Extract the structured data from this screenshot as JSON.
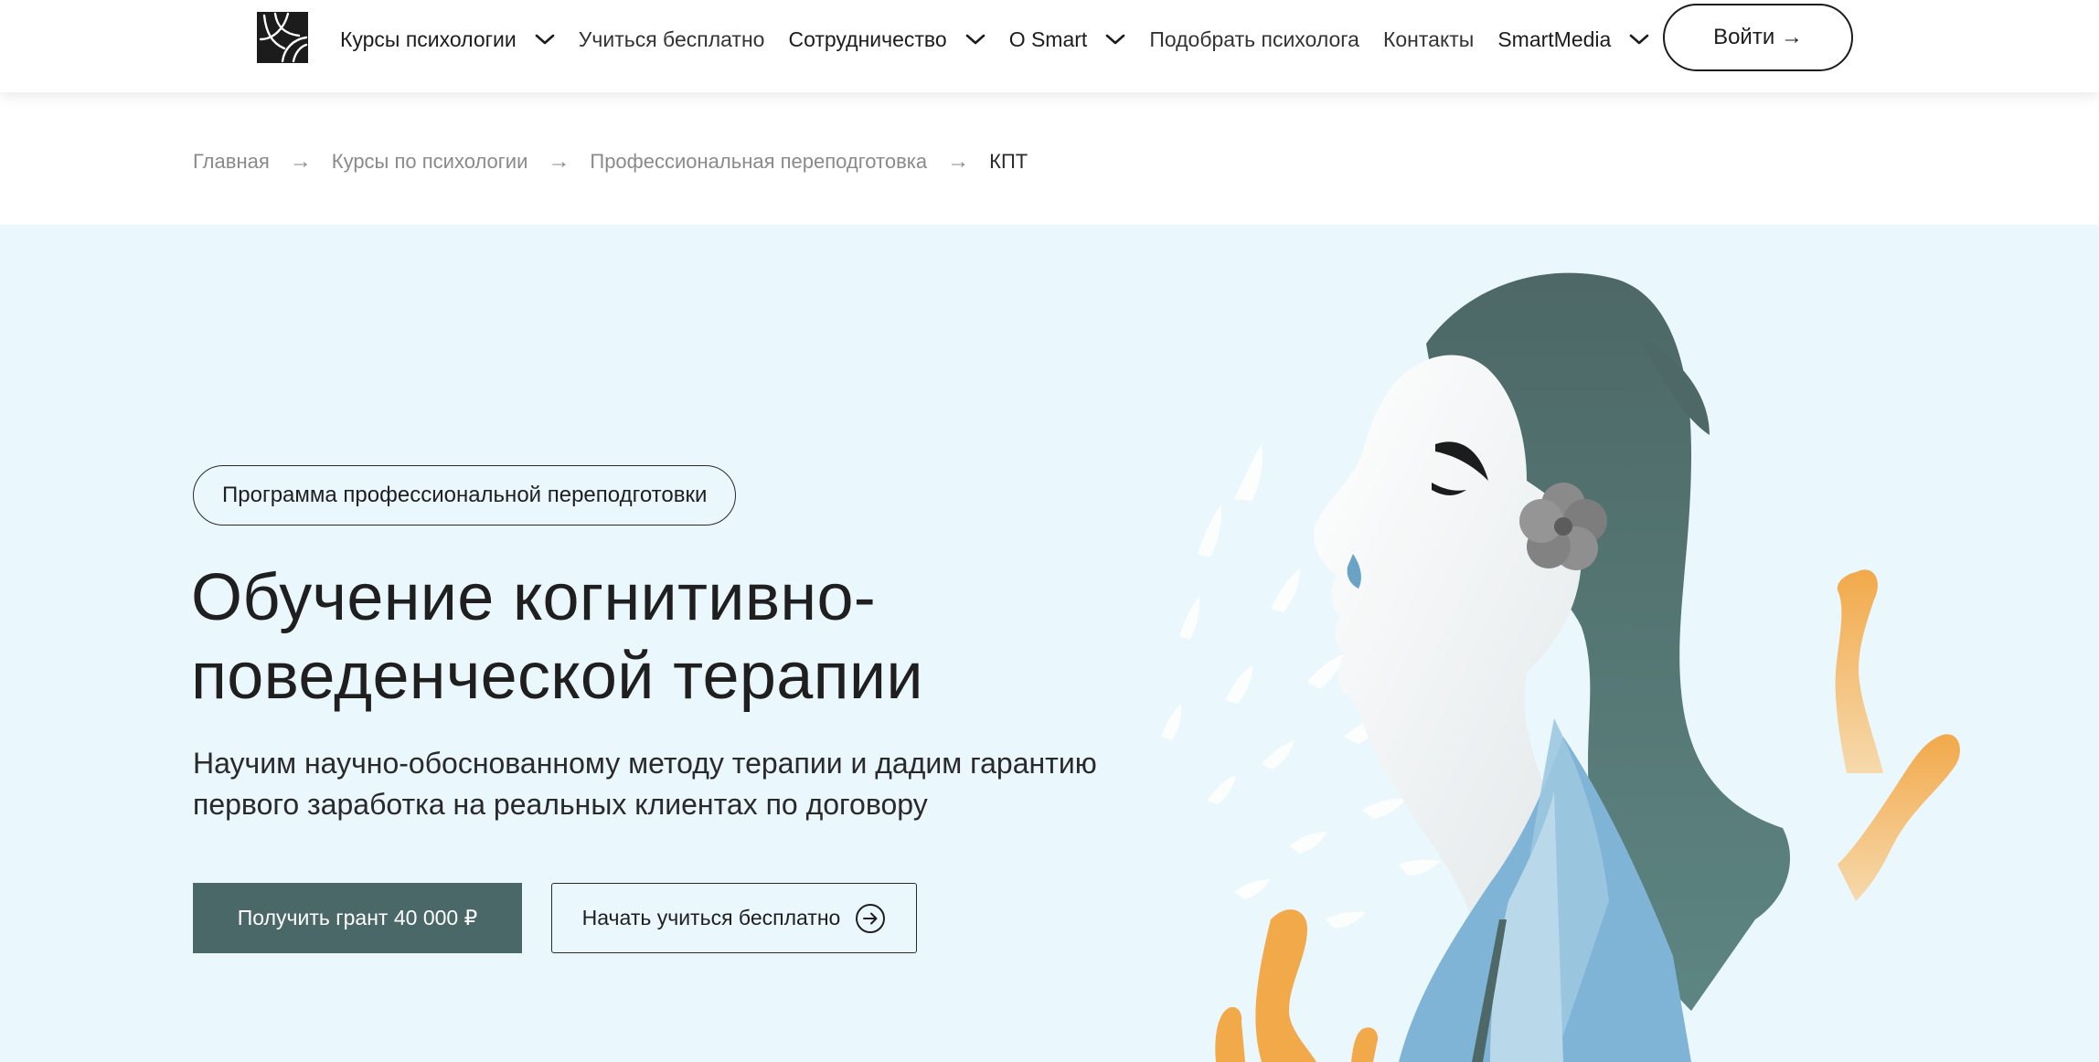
{
  "header": {
    "nav": [
      {
        "label": "Курсы психологии",
        "has_dropdown": true
      },
      {
        "label": "Учиться бесплатно",
        "has_dropdown": false
      },
      {
        "label": "Сотрудничество",
        "has_dropdown": true
      },
      {
        "label": "О Smart",
        "has_dropdown": true
      },
      {
        "label": "Подобрать психолога",
        "has_dropdown": false
      },
      {
        "label": "Контакты",
        "has_dropdown": false
      },
      {
        "label": "SmartMedia",
        "has_dropdown": true
      }
    ],
    "login_label": "Войти →"
  },
  "breadcrumb": {
    "items": [
      "Главная",
      "Курсы по психологии",
      "Профессиональная переподготовка",
      "КПТ"
    ],
    "separator": "→"
  },
  "hero": {
    "badge": "Программа профессиональной переподготовки",
    "title_line1": "Обучение когнитивно-",
    "title_line2": "поведенческой терапии",
    "subtitle_line1": "Научим научно-обоснованному методу терапии и дадим гарантию",
    "subtitle_line2": "первого заработка на реальных клиентах по договору",
    "primary_button": "Получить грант 40 000 ₽",
    "secondary_button": "Начать учиться бесплатно"
  },
  "colors": {
    "accent_dark_teal": "#4a6868",
    "hero_background": "#eaf7fc",
    "text": "#1f1f1f",
    "muted": "#8a8a8a",
    "orange": "#f2a94a"
  }
}
